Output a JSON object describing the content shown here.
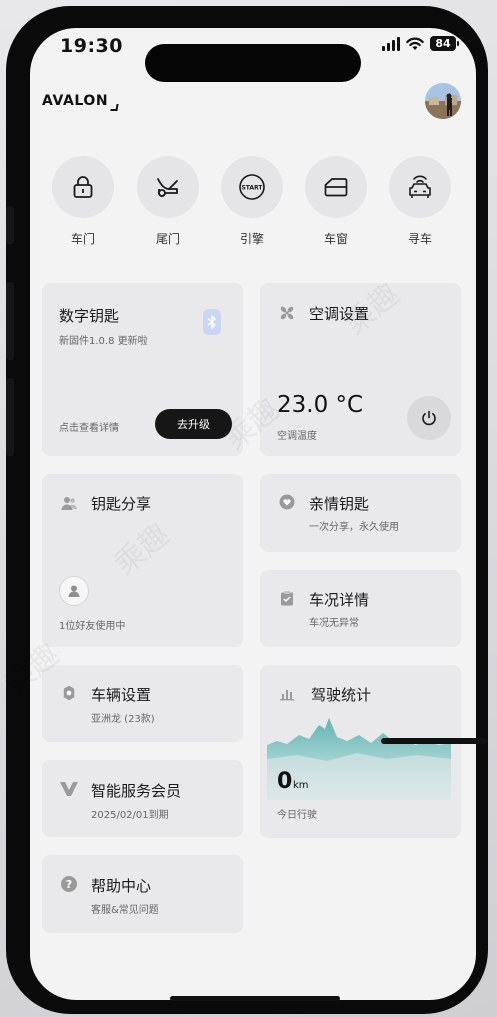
{
  "status": {
    "time": "19:30",
    "battery": "84"
  },
  "header": {
    "brand": "AVALON"
  },
  "quick_actions": [
    {
      "label": "车门",
      "icon": "lock-icon"
    },
    {
      "label": "尾门",
      "icon": "trunk-icon"
    },
    {
      "label": "引擎",
      "icon": "engine-start-icon",
      "icon_text": "START"
    },
    {
      "label": "车窗",
      "icon": "window-icon"
    },
    {
      "label": "寻车",
      "icon": "find-car-icon"
    }
  ],
  "cards": {
    "digital_key": {
      "title": "数字钥匙",
      "subtitle": "新固件1.0.8 更新啦",
      "hint": "点击查看详情",
      "button": "去升级"
    },
    "ac": {
      "title": "空调设置",
      "temperature": "23.0 °C",
      "temp_label": "空调温度"
    },
    "key_share": {
      "title": "钥匙分享",
      "friends": "1位好友使用中"
    },
    "family_key": {
      "title": "亲情钥匙",
      "subtitle": "一次分享，永久使用"
    },
    "vehicle_status": {
      "title": "车况详情",
      "subtitle": "车况无异常"
    },
    "vehicle_settings": {
      "title": "车辆设置",
      "subtitle": "亚洲龙 (23款)"
    },
    "drive_stats": {
      "title": "驾驶统计",
      "distance": "0",
      "unit": "km",
      "label": "今日行驶"
    },
    "membership": {
      "title": "智能服务会员",
      "subtitle": "2025/02/01到期"
    },
    "help": {
      "title": "帮助中心",
      "subtitle": "客服&常见问题"
    }
  },
  "watermark": "乘趣",
  "colors": {
    "card_bg": "#e9e9eb",
    "chart_fill": "#8fd0cf",
    "bluetooth_badge": "#c9d6f2",
    "button_dark": "#161616"
  }
}
